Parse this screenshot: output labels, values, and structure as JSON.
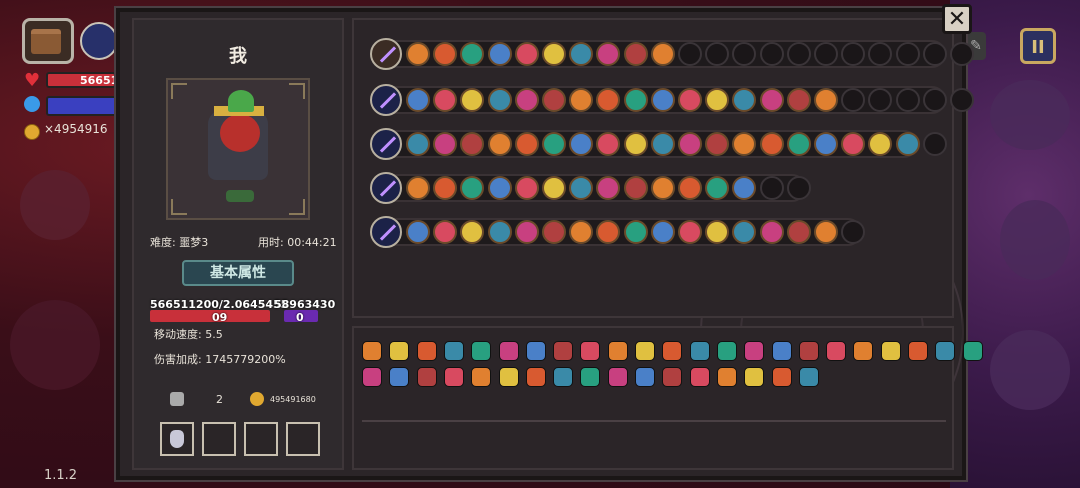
{
  "hud": {
    "hp_value": "56651",
    "gold_value": "×4954916",
    "version": "1.1.2",
    "pause_label": "II"
  },
  "panel": {
    "close_label": "✕",
    "player_name": "我",
    "difficulty": "难度: 噩梦3",
    "time_used": "用时: 00:44:21",
    "section_title": "基本属性",
    "hp_text": "566511200/2.0645455",
    "hp_text2": "09",
    "mp_text": "58963430",
    "mp_text2": "0",
    "move_speed": "移动速度: 5.5",
    "damage_bonus": "伤害加成: 1745779200%",
    "key_count": "2",
    "gold_count": "495491680"
  },
  "colors": {
    "slot_palette": [
      "#e08030",
      "#d85a30",
      "#28a080",
      "#4a80c8",
      "#d84a60",
      "#e0c040",
      "#3a8aa8",
      "#c84080",
      "#b04040"
    ]
  }
}
